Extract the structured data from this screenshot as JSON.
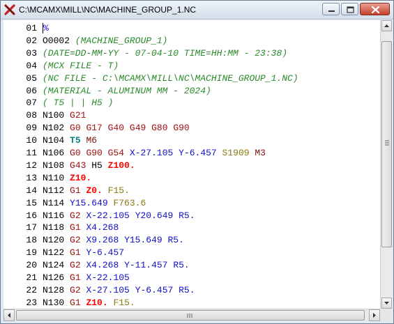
{
  "window": {
    "title": "C:\\MCAMX\\MILL\\NC\\MACHINE_GROUP_1.NC",
    "icon": "mastercam-x-icon",
    "controls": [
      "minimize",
      "maximize",
      "close"
    ]
  },
  "colors": {
    "number": "#000000",
    "gcode": "#a01010",
    "xy": "#1010c8",
    "z": "#ff0000",
    "feed": "#8a7a10",
    "mcode": "#7a1010",
    "tool": "#0a8080",
    "comment": "#2a8a2a"
  },
  "editor": {
    "lines": [
      {
        "ln": "01",
        "tokens": [
          {
            "t": "%",
            "k": "p"
          }
        ]
      },
      {
        "ln": "02",
        "tokens": [
          {
            "t": "O0002",
            "k": "o"
          },
          {
            "t": "(MACHINE_GROUP_1)",
            "k": "c"
          }
        ]
      },
      {
        "ln": "03",
        "tokens": [
          {
            "t": "(DATE=DD-MM-YY - 07-04-10 TIME=HH:MM - 23:38)",
            "k": "c"
          }
        ]
      },
      {
        "ln": "04",
        "tokens": [
          {
            "t": "(MCX FILE - T)",
            "k": "c"
          }
        ]
      },
      {
        "ln": "05",
        "tokens": [
          {
            "t": "(NC FILE - C:\\MCAMX\\MILL\\NC\\MACHINE_GROUP_1.NC)",
            "k": "c"
          }
        ]
      },
      {
        "ln": "06",
        "tokens": [
          {
            "t": "(MATERIAL - ALUMINUM MM - 2024)",
            "k": "c"
          }
        ]
      },
      {
        "ln": "07",
        "tokens": [
          {
            "t": "( T5 | | H5 )",
            "k": "c"
          }
        ]
      },
      {
        "ln": "08",
        "tokens": [
          {
            "t": "N100",
            "k": "n"
          },
          {
            "t": "G21",
            "k": "g"
          }
        ]
      },
      {
        "ln": "09",
        "tokens": [
          {
            "t": "N102",
            "k": "n"
          },
          {
            "t": "G0",
            "k": "g"
          },
          {
            "t": "G17",
            "k": "g"
          },
          {
            "t": "G40",
            "k": "g"
          },
          {
            "t": "G49",
            "k": "g"
          },
          {
            "t": "G80",
            "k": "g"
          },
          {
            "t": "G90",
            "k": "g"
          }
        ]
      },
      {
        "ln": "10",
        "tokens": [
          {
            "t": "N104",
            "k": "n"
          },
          {
            "t": "T5",
            "k": "t"
          },
          {
            "t": "M6",
            "k": "m"
          }
        ]
      },
      {
        "ln": "11",
        "tokens": [
          {
            "t": "N106",
            "k": "n"
          },
          {
            "t": "G0",
            "k": "g"
          },
          {
            "t": "G90",
            "k": "g"
          },
          {
            "t": "G54",
            "k": "g"
          },
          {
            "t": "X-27.105",
            "k": "x"
          },
          {
            "t": "Y-6.457",
            "k": "y"
          },
          {
            "t": "S1909",
            "k": "s"
          },
          {
            "t": "M3",
            "k": "m"
          }
        ]
      },
      {
        "ln": "12",
        "tokens": [
          {
            "t": "N108",
            "k": "n"
          },
          {
            "t": "G43",
            "k": "g"
          },
          {
            "t": "H5",
            "k": "h"
          },
          {
            "t": "Z100.",
            "k": "z"
          }
        ]
      },
      {
        "ln": "13",
        "tokens": [
          {
            "t": "N110",
            "k": "n"
          },
          {
            "t": "Z10.",
            "k": "z"
          }
        ]
      },
      {
        "ln": "14",
        "tokens": [
          {
            "t": "N112",
            "k": "n"
          },
          {
            "t": "G1",
            "k": "g"
          },
          {
            "t": "Z0.",
            "k": "z"
          },
          {
            "t": "F15.",
            "k": "f"
          }
        ]
      },
      {
        "ln": "15",
        "tokens": [
          {
            "t": "N114",
            "k": "n"
          },
          {
            "t": "Y15.649",
            "k": "y"
          },
          {
            "t": "F763.6",
            "k": "f"
          }
        ]
      },
      {
        "ln": "16",
        "tokens": [
          {
            "t": "N116",
            "k": "n"
          },
          {
            "t": "G2",
            "k": "g"
          },
          {
            "t": "X-22.105",
            "k": "x"
          },
          {
            "t": "Y20.649",
            "k": "y"
          },
          {
            "t": "R5.",
            "k": "r"
          }
        ]
      },
      {
        "ln": "17",
        "tokens": [
          {
            "t": "N118",
            "k": "n"
          },
          {
            "t": "G1",
            "k": "g"
          },
          {
            "t": "X4.268",
            "k": "x"
          }
        ]
      },
      {
        "ln": "18",
        "tokens": [
          {
            "t": "N120",
            "k": "n"
          },
          {
            "t": "G2",
            "k": "g"
          },
          {
            "t": "X9.268",
            "k": "x"
          },
          {
            "t": "Y15.649",
            "k": "y"
          },
          {
            "t": "R5.",
            "k": "r"
          }
        ]
      },
      {
        "ln": "19",
        "tokens": [
          {
            "t": "N122",
            "k": "n"
          },
          {
            "t": "G1",
            "k": "g"
          },
          {
            "t": "Y-6.457",
            "k": "y"
          }
        ]
      },
      {
        "ln": "20",
        "tokens": [
          {
            "t": "N124",
            "k": "n"
          },
          {
            "t": "G2",
            "k": "g"
          },
          {
            "t": "X4.268",
            "k": "x"
          },
          {
            "t": "Y-11.457",
            "k": "y"
          },
          {
            "t": "R5.",
            "k": "r"
          }
        ]
      },
      {
        "ln": "21",
        "tokens": [
          {
            "t": "N126",
            "k": "n"
          },
          {
            "t": "G1",
            "k": "g"
          },
          {
            "t": "X-22.105",
            "k": "x"
          }
        ]
      },
      {
        "ln": "22",
        "tokens": [
          {
            "t": "N128",
            "k": "n"
          },
          {
            "t": "G2",
            "k": "g"
          },
          {
            "t": "X-27.105",
            "k": "x"
          },
          {
            "t": "Y-6.457",
            "k": "y"
          },
          {
            "t": "R5.",
            "k": "r"
          }
        ]
      },
      {
        "ln": "23",
        "tokens": [
          {
            "t": "N130",
            "k": "n"
          },
          {
            "t": "G1",
            "k": "g"
          },
          {
            "t": "Z10.",
            "k": "z"
          },
          {
            "t": "F15.",
            "k": "f"
          }
        ]
      }
    ]
  }
}
